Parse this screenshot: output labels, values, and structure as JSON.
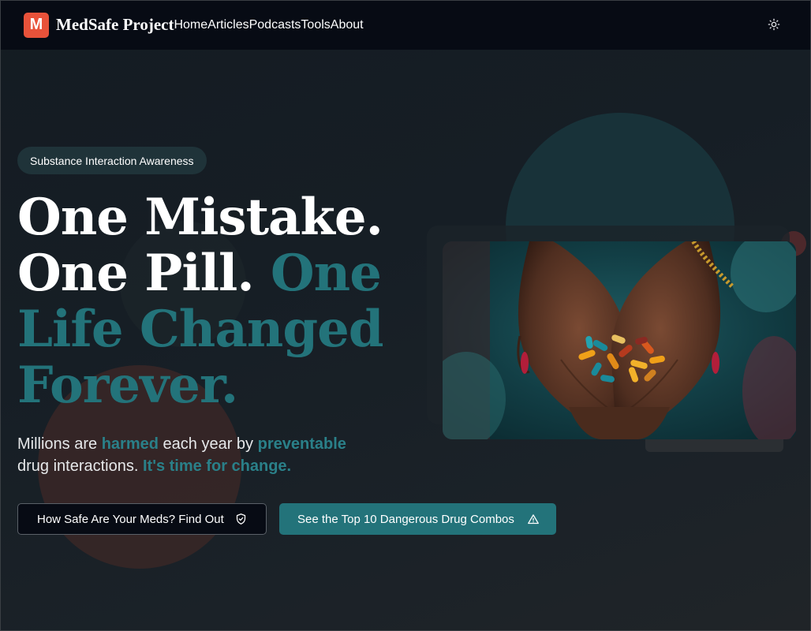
{
  "header": {
    "logo_letter": "M",
    "logo_text": "MedSafe Project",
    "nav": [
      {
        "label": "Home"
      },
      {
        "label": "Articles"
      },
      {
        "label": "Podcasts"
      },
      {
        "label": "Tools"
      },
      {
        "label": "About"
      }
    ],
    "theme_icon": "sun-icon"
  },
  "hero": {
    "badge": "Substance Interaction Awareness",
    "headline": {
      "line1": "One Mistake.",
      "line2_white": "One Pill.",
      "line2_teal": "One",
      "line3": "Life Changed",
      "line4": "Forever."
    },
    "subtext": {
      "p1": "Millions are",
      "hl1": "harmed",
      "p2": "each year by",
      "hl2": "preventable",
      "p3": "drug interactions.",
      "hl3": "It's time for change."
    },
    "buttons": [
      {
        "label": "How Safe Are Your Meds? Find Out",
        "icon": "shield-check-icon"
      },
      {
        "label": "See the Top 10 Dangerous Drug Combos",
        "icon": "warning-icon"
      }
    ]
  },
  "colors": {
    "accent_teal": "#23737a",
    "logo_red": "#e8523a",
    "header_bg": "#070b14"
  }
}
